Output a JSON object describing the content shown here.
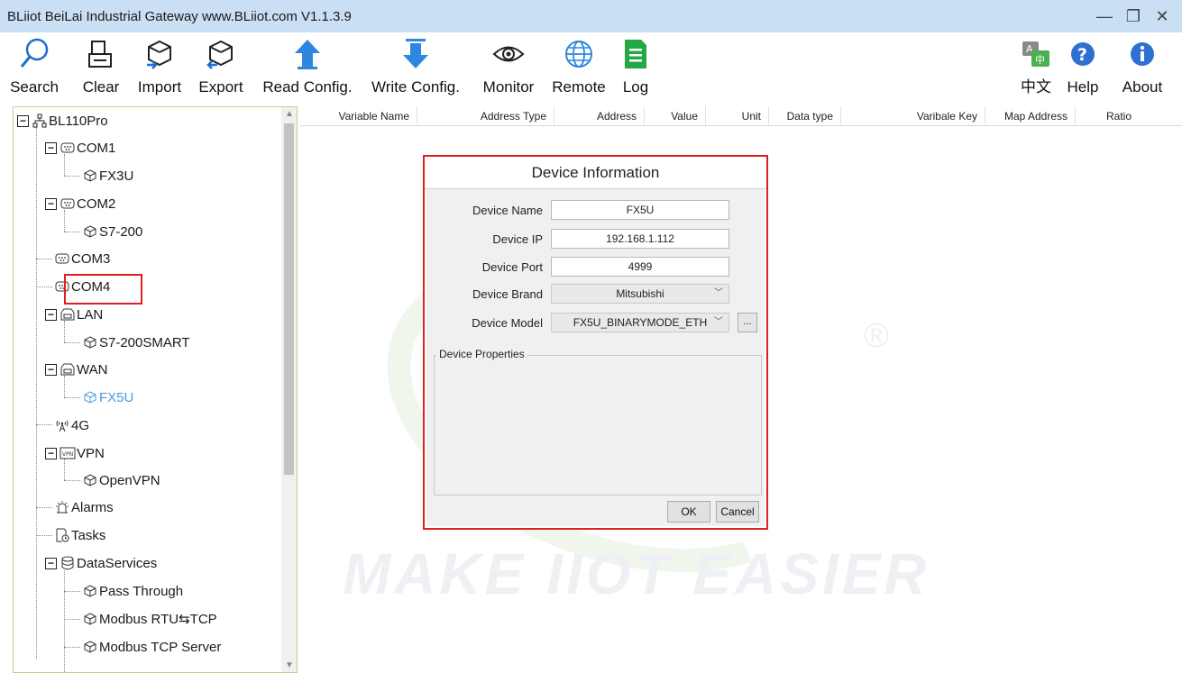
{
  "window": {
    "title": "BLiiot BeiLai Industrial Gateway www.BLiiot.com V1.1.3.9",
    "controls": [
      "—",
      "❐",
      "✕"
    ]
  },
  "toolbar": {
    "buttons": [
      {
        "label": "Search",
        "icon": "search-icon"
      },
      {
        "label": "Clear",
        "icon": "clear-icon"
      },
      {
        "label": "Import",
        "icon": "import-icon"
      },
      {
        "label": "Export",
        "icon": "export-icon"
      },
      {
        "label": "Read Config.",
        "icon": "upload-icon"
      },
      {
        "label": "Write Config.",
        "icon": "download-icon"
      },
      {
        "label": "Monitor",
        "icon": "eye-icon"
      },
      {
        "label": "Remote",
        "icon": "globe-icon"
      },
      {
        "label": "Log",
        "icon": "document-icon"
      },
      {
        "label": "中文",
        "icon": "language-icon"
      },
      {
        "label": "Help",
        "icon": "help-icon"
      },
      {
        "label": "About",
        "icon": "info-icon"
      }
    ]
  },
  "tree": {
    "root": "BL110Pro",
    "items": [
      {
        "label": "COM1"
      },
      {
        "label": "FX3U"
      },
      {
        "label": "COM2"
      },
      {
        "label": "S7-200"
      },
      {
        "label": "COM3"
      },
      {
        "label": "COM4"
      },
      {
        "label": "LAN"
      },
      {
        "label": "S7-200SMART"
      },
      {
        "label": "WAN"
      },
      {
        "label": "FX5U"
      },
      {
        "label": "4G"
      },
      {
        "label": "VPN"
      },
      {
        "label": "OpenVPN"
      },
      {
        "label": "Alarms"
      },
      {
        "label": "Tasks"
      },
      {
        "label": "DataServices"
      },
      {
        "label": "Pass Through"
      },
      {
        "label": "Modbus RTU⇆TCP"
      },
      {
        "label": "Modbus TCP Server"
      }
    ],
    "vpn_badge": "VPN"
  },
  "table": {
    "columns": [
      "Variable Name",
      "Address Type",
      "Address",
      "Value",
      "Unit",
      "Data type",
      "Varibale Key",
      "Map Address",
      "Ratio"
    ]
  },
  "watermark": {
    "text": "MAKE IIOT EASIER",
    "registered": "®"
  },
  "dialog": {
    "title": "Device Information",
    "fields": {
      "name_label": "Device Name",
      "name_value": "FX5U",
      "ip_label": "Device IP",
      "ip_value": "192.168.1.112",
      "port_label": "Device Port",
      "port_value": "4999",
      "brand_label": "Device Brand",
      "brand_value": "Mitsubishi",
      "model_label": "Device Model",
      "model_value": "FX5U_BINARYMODE_ETH",
      "more_label": "..."
    },
    "properties_label": "Device Properties",
    "ok_label": "OK",
    "cancel_label": "Cancel"
  }
}
